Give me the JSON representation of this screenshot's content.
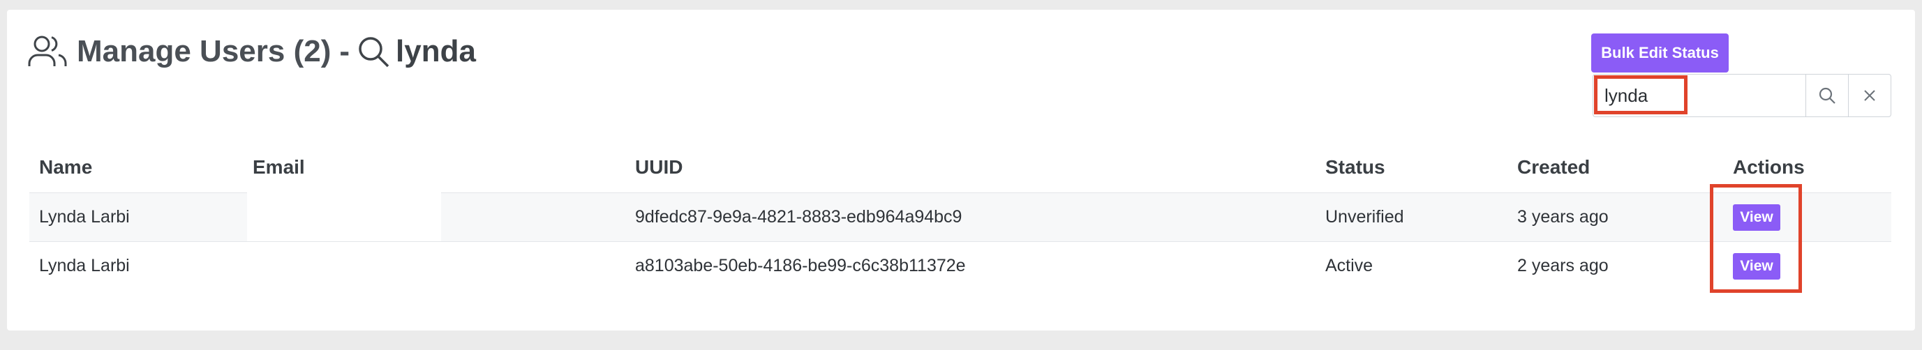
{
  "header": {
    "title": "Manage Users (2)",
    "dash": "-",
    "query": "lynda"
  },
  "toolbar": {
    "bulk_edit_label": "Bulk Edit Status",
    "search_value": "lynda"
  },
  "table": {
    "columns": [
      "Name",
      "Email",
      "UUID",
      "Status",
      "Created",
      "Actions"
    ],
    "rows": [
      {
        "name": "Lynda Larbi",
        "email": "",
        "uuid": "9dfedc87-9e9a-4821-8883-edb964a94bc9",
        "status": "Unverified",
        "created": "3 years ago",
        "action": "View"
      },
      {
        "name": "Lynda Larbi",
        "email": "",
        "uuid": "a8103abe-50eb-4186-be99-c6c38b11372e",
        "status": "Active",
        "created": "2 years ago",
        "action": "View"
      }
    ]
  },
  "colors": {
    "accent": "#8b5cf6",
    "highlight": "#e0432b",
    "background": "#ebebeb"
  },
  "icons": [
    "users-icon",
    "search-icon",
    "close-icon"
  ]
}
